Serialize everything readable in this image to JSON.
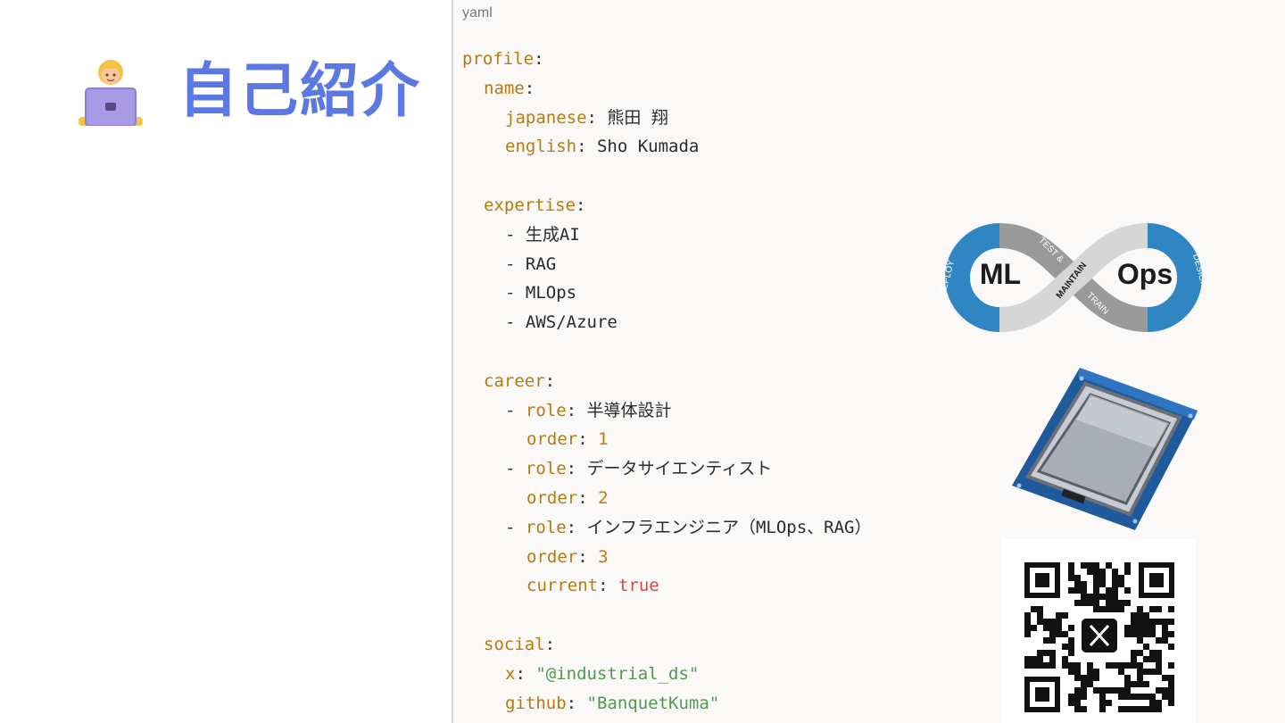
{
  "header": {
    "title": "自己紹介",
    "avatar_icon": "person-with-laptop-icon"
  },
  "code_block": {
    "language": "yaml",
    "profile_key": "profile",
    "name_key": "name",
    "japanese_key": "japanese",
    "japanese_value": "熊田 翔",
    "english_key": "english",
    "english_value": "Sho Kumada",
    "expertise_key": "expertise",
    "expertise": [
      "生成AI",
      "RAG",
      "MLOps",
      "AWS/Azure"
    ],
    "career_key": "career",
    "role_key": "role",
    "order_key": "order",
    "current_key": "current",
    "current_value": "true",
    "career": [
      {
        "role": "半導体設計",
        "order": "1"
      },
      {
        "role": "データサイエンティスト",
        "order": "2"
      },
      {
        "role": "インフラエンジニア（MLOps、RAG）",
        "order": "3"
      }
    ],
    "social_key": "social",
    "x_key": "x",
    "x_value": "\"@industrial_ds\"",
    "github_key": "github",
    "github_value": "\"BanquetKuma\""
  },
  "mlops_logo": {
    "ml": "ML",
    "ops": "Ops",
    "deploy": "DEPLOY",
    "design": "DESIGN",
    "test": "TEST &",
    "maintain": "MAINTAIN",
    "train": "TRAIN"
  },
  "colors": {
    "title": "#5b78e3",
    "key": "#b57a12",
    "string": "#4f9a4f",
    "bool": "#d04a4a",
    "mlops_blue": "#2f86c2"
  },
  "illustrations": {
    "chip": "cpu-chip-icon",
    "qr": "qr-code-x-icon",
    "qr_logo": "x-logo-icon"
  }
}
